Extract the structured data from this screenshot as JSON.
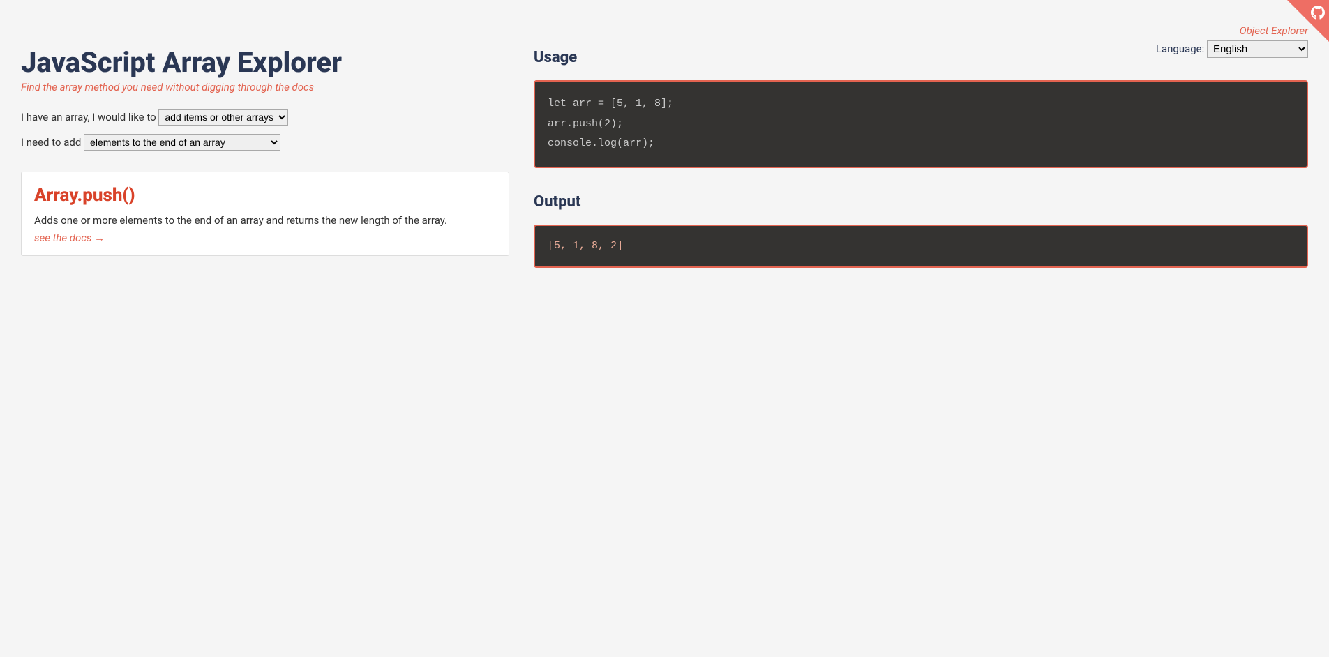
{
  "nav": {
    "object_explorer_link": "Object Explorer",
    "language_label": "Language:",
    "language_selected": "English"
  },
  "header": {
    "title": "JavaScript Array Explorer",
    "subtitle": "Find the array method you need without digging through the docs"
  },
  "selectors": {
    "first_label": "I have an array, I would like to",
    "first_selected": "add items or other arrays",
    "second_label": "I need to add",
    "second_selected": "elements to the end of an array"
  },
  "result": {
    "method": "Array.push()",
    "description": "Adds one or more elements to the end of an array and returns the new length of the array.",
    "docs_link": "see the docs →"
  },
  "usage": {
    "heading": "Usage",
    "code": "let arr = [5, 1, 8];\narr.push(2);\nconsole.log(arr);"
  },
  "output": {
    "heading": "Output",
    "code": "[5, 1, 8, 2]"
  }
}
